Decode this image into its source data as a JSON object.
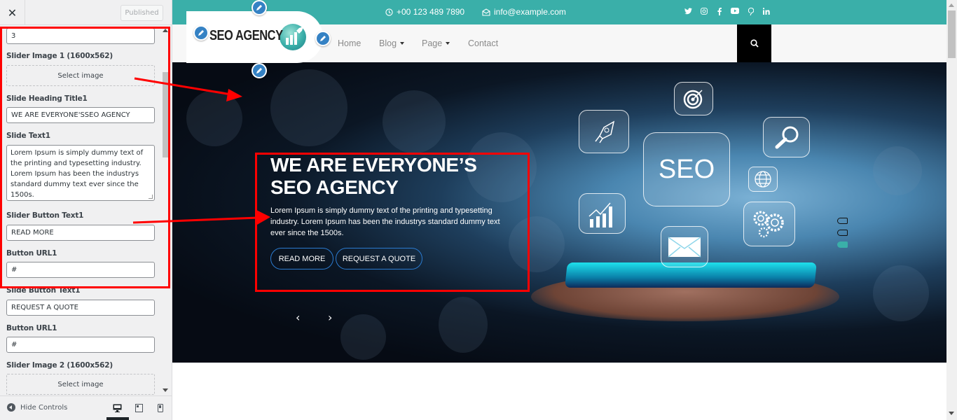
{
  "sidebar": {
    "close_icon": "close-icon",
    "publish_button": "Published",
    "fields": {
      "slide_count_value": "3",
      "slider_image_1_label": "Slider Image 1 (1600x562)",
      "select_image_label": "Select image",
      "slide_heading_1_label": "Slide Heading Title1",
      "slide_heading_1_value": "WE ARE EVERYONE'SSEO AGENCY",
      "slide_text_1_label": "Slide Text1",
      "slide_text_1_value": "Lorem Ipsum is simply dummy text of the printing and typesetting industry. Lorem Ipsum has been the industrys standard dummy text ever since the 1500s.",
      "slider_button_text_1_label": "Slider Button Text1",
      "slider_button_text_1_value": "READ MORE",
      "button_url_1_label": "Button URL1",
      "button_url_1_value": "#",
      "slide_button_text_1b_label": "Slide Button Text1",
      "slide_button_text_1b_value": "REQUEST A QUOTE",
      "button_url_1b_label": "Button URL1",
      "button_url_1b_value": "#",
      "slider_image_2_label": "Slider Image 2 (1600x562)",
      "select_image_2_label": "Select image"
    },
    "footer": {
      "hide_controls_label": "Hide Controls",
      "devices": [
        "desktop",
        "tablet",
        "mobile"
      ],
      "active_device": "desktop"
    }
  },
  "site": {
    "topbar": {
      "phone": "+00 123 489 7890",
      "email": "info@example.com",
      "social": [
        "twitter",
        "instagram",
        "facebook",
        "youtube",
        "pinterest",
        "linkedin"
      ]
    },
    "logo_text": "SEO AGENCY",
    "nav": [
      {
        "label": "Home",
        "has_dropdown": false
      },
      {
        "label": "Blog",
        "has_dropdown": true
      },
      {
        "label": "Page",
        "has_dropdown": true
      },
      {
        "label": "Contact",
        "has_dropdown": false
      }
    ],
    "hero": {
      "title_line1": "WE ARE EVERYONE’S",
      "title_line2": "SEO AGENCY",
      "text": "Lorem Ipsum is simply dummy text of the printing and typesetting industry. Lorem Ipsum has been the industrys standard dummy text ever since the 1500s.",
      "button_primary": "READ MORE",
      "button_secondary": "REQUEST A QUOTE",
      "prev_arrow": "‹",
      "next_arrow": "›",
      "holo_seo_label": "SEO",
      "slide_count": 3,
      "active_slide": 3
    }
  },
  "colors": {
    "brand_teal": "#3aafa9",
    "annotation_red": "#ff0000",
    "button_border_blue": "#2b7bd0",
    "edit_pencil_blue": "#3582c4"
  }
}
